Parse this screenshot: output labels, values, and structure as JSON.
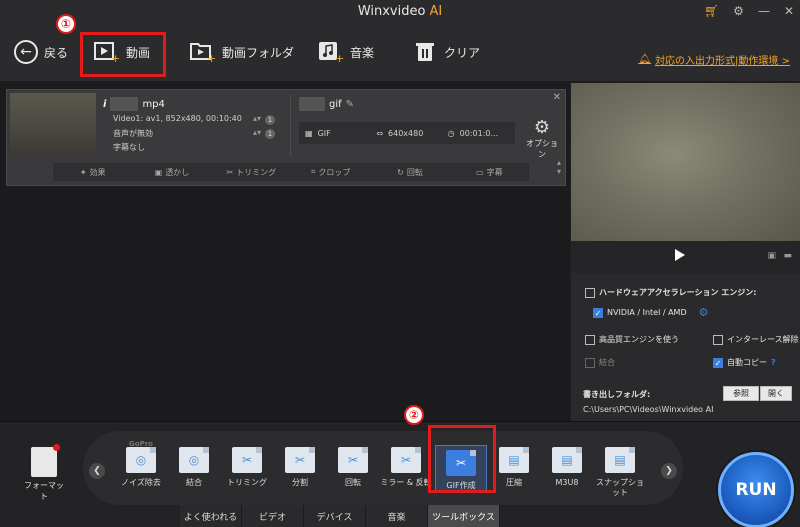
{
  "app": {
    "title": "Winxvideo",
    "title_ai": "AI"
  },
  "window_icons": {
    "cart": "cart-icon",
    "settings": "gear-icon",
    "minimize": "minimize-icon",
    "close": "close-icon"
  },
  "toolbar": {
    "back_label": "戻る",
    "video_label": "動画",
    "video_folder_label": "動画フォルダ",
    "music_label": "音楽",
    "clear_label": "クリア",
    "support_link": "対応の入出力形式|動作環境 >"
  },
  "annotations": {
    "mark1": "①",
    "mark2": "②"
  },
  "file_card": {
    "source_ext": "mp4",
    "source_info_icon": "i",
    "source_video": "Video1: av1, 852x480, 00:10:40",
    "source_audio": "音声が無効",
    "source_subtitle": "字幕なし",
    "badge": "1",
    "target_ext": "gif",
    "target_format": "GIF",
    "target_resolution": "640x480",
    "target_duration": "00:01:0...",
    "option_label": "オプション",
    "tools": [
      "効果",
      "透かし",
      "トリミング",
      "クロップ",
      "回転",
      "字幕"
    ]
  },
  "settings": {
    "hw_title": "ハードウェアアクセラレーション エンジン:",
    "hw_option": "NVIDIA / Intel / AMD",
    "high_quality": "高品質エンジンを使う",
    "deinterlace": "インターレース解除",
    "merge": "結合",
    "auto_copy": "自動コピー",
    "help": "?",
    "output_folder_label": "書き出しフォルダ:",
    "browse_button": "参照",
    "open_button": "開く",
    "output_path": "C:\\Users\\PC\\Videos\\Winxvideo AI"
  },
  "bottom": {
    "format_label": "フォーマット",
    "tools": [
      {
        "label": "ノイズ除去",
        "note": "GoPro"
      },
      {
        "label": "結合"
      },
      {
        "label": "トリミング"
      },
      {
        "label": "分割"
      },
      {
        "label": "回転"
      },
      {
        "label": "ミラー & 反転"
      },
      {
        "label": "GIF作成"
      },
      {
        "label": "圧縮"
      },
      {
        "label": "M3U8"
      },
      {
        "label": "スナップショット"
      }
    ],
    "tabs": [
      "よく使われる",
      "ビデオ",
      "デバイス",
      "音楽",
      "ツールボックス"
    ],
    "active_tab": "ツールボックス",
    "run_label": "RUN"
  }
}
